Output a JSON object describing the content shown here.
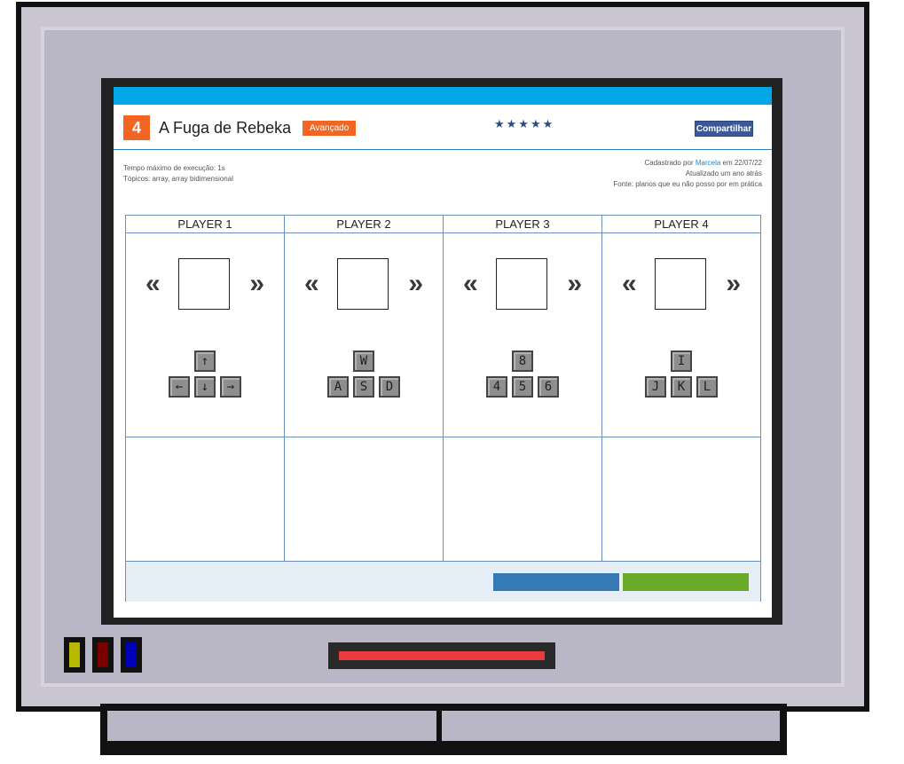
{
  "game": {
    "number": "4",
    "title": "A Fuga de Rebeka",
    "level": "Avançado",
    "rating_stars": "★★★★★",
    "share_label": "Compartilhar",
    "meta_left": [
      "Tempo máximo de execução: 1s",
      "Tópicos: array, array bidimensional"
    ],
    "meta_right": {
      "prefix": "Cadastrado por ",
      "author": "Marcela",
      "suffix": " em 22/07/22",
      "updated": "Atualizado um ano atrás",
      "source": "Fonte: planos que eu não posso por em prática"
    }
  },
  "players": [
    {
      "label": "PLAYER 1",
      "arrow_left": "«",
      "arrow_right": "»",
      "keys": {
        "up": "↑",
        "left": "←",
        "down": "↓",
        "right": "→"
      }
    },
    {
      "label": "PLAYER 2",
      "arrow_left": "«",
      "arrow_right": "»",
      "keys": {
        "up": "W",
        "left": "A",
        "down": "S",
        "right": "D"
      }
    },
    {
      "label": "PLAYER 3",
      "arrow_left": "«",
      "arrow_right": "»",
      "keys": {
        "up": "8",
        "left": "4",
        "down": "5",
        "right": "6"
      }
    },
    {
      "label": "PLAYER 4",
      "arrow_left": "«",
      "arrow_right": "»",
      "keys": {
        "up": "I",
        "left": "J",
        "down": "K",
        "right": "L"
      }
    }
  ],
  "colors": {
    "topbar": "#00a6e6",
    "accent_orange": "#f26522",
    "button_blue": "#337ab7",
    "button_green": "#6aaa28",
    "led_yellow": "#b8b800",
    "led_red": "#7a0000",
    "led_blue": "#0000b8"
  }
}
